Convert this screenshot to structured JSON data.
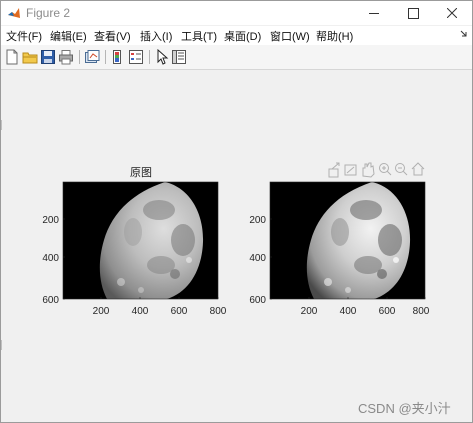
{
  "window": {
    "title": "Figure 2"
  },
  "menu": [
    {
      "label": "文件(F)"
    },
    {
      "label": "编辑(E)"
    },
    {
      "label": "查看(V)"
    },
    {
      "label": "插入(I)"
    },
    {
      "label": "工具(T)"
    },
    {
      "label": "桌面(D)"
    },
    {
      "label": "窗口(W)"
    },
    {
      "label": "帮助(H)"
    }
  ],
  "toolbar_icons": [
    "new-figure-icon",
    "open-file-icon",
    "save-icon",
    "print-icon",
    "link-plot-icon",
    "insert-colorbar-icon",
    "insert-legend-icon",
    "edit-plot-pointer-icon",
    "property-inspector-icon"
  ],
  "axes_toolbar_icons": [
    "export-icon",
    "brush-icon",
    "pan-icon",
    "zoom-in-icon",
    "zoom-out-icon",
    "home-icon"
  ],
  "left_plot": {
    "title": "原图",
    "x_ticks": [
      "200",
      "400",
      "600",
      "800"
    ],
    "y_ticks": [
      "200",
      "400",
      "600"
    ]
  },
  "right_plot": {
    "title": "",
    "x_ticks": [
      "200",
      "400",
      "600",
      "800"
    ],
    "y_ticks": [
      "200",
      "400",
      "600"
    ]
  },
  "watermark": "CSDN @夹小汁"
}
